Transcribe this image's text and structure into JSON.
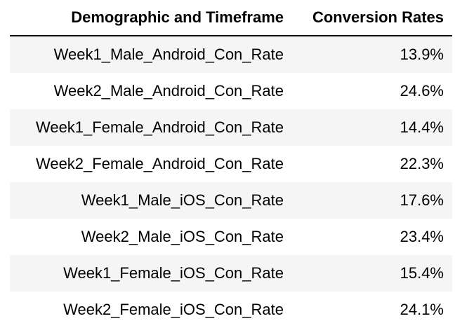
{
  "table": {
    "headers": [
      "Demographic and Timeframe",
      "Conversion Rates"
    ],
    "rows": [
      {
        "label": "Week1_Male_Android_Con_Rate",
        "value": "13.9%"
      },
      {
        "label": "Week2_Male_Android_Con_Rate",
        "value": "24.6%"
      },
      {
        "label": "Week1_Female_Android_Con_Rate",
        "value": "14.4%"
      },
      {
        "label": "Week2_Female_Android_Con_Rate",
        "value": "22.3%"
      },
      {
        "label": "Week1_Male_iOS_Con_Rate",
        "value": "17.6%"
      },
      {
        "label": "Week2_Male_iOS_Con_Rate",
        "value": "23.4%"
      },
      {
        "label": "Week1_Female_iOS_Con_Rate",
        "value": "15.4%"
      },
      {
        "label": "Week2_Female_iOS_Con_Rate",
        "value": "24.1%"
      }
    ]
  }
}
